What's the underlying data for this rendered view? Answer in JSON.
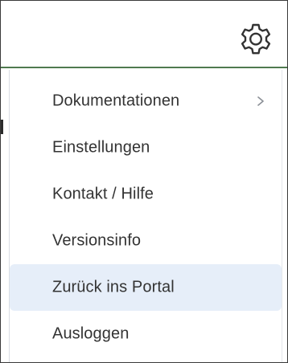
{
  "header": {
    "settings_icon": "gear-icon"
  },
  "menu": {
    "items": [
      {
        "label": "Dokumentationen",
        "has_submenu": true,
        "submenu_icon": "chevron-right-icon",
        "highlighted": false
      },
      {
        "label": "Einstellungen",
        "has_submenu": false,
        "highlighted": false
      },
      {
        "label": "Kontakt / Hilfe",
        "has_submenu": false,
        "highlighted": false
      },
      {
        "label": "Versionsinfo",
        "has_submenu": false,
        "highlighted": false
      },
      {
        "label": "Zurück ins Portal",
        "has_submenu": false,
        "highlighted": true
      },
      {
        "label": "Ausloggen",
        "has_submenu": false,
        "highlighted": false
      }
    ]
  },
  "colors": {
    "highlight_background": "#e6eef9",
    "header_divider": "#4f7a4f",
    "text": "#333333",
    "icon": "#333333"
  }
}
